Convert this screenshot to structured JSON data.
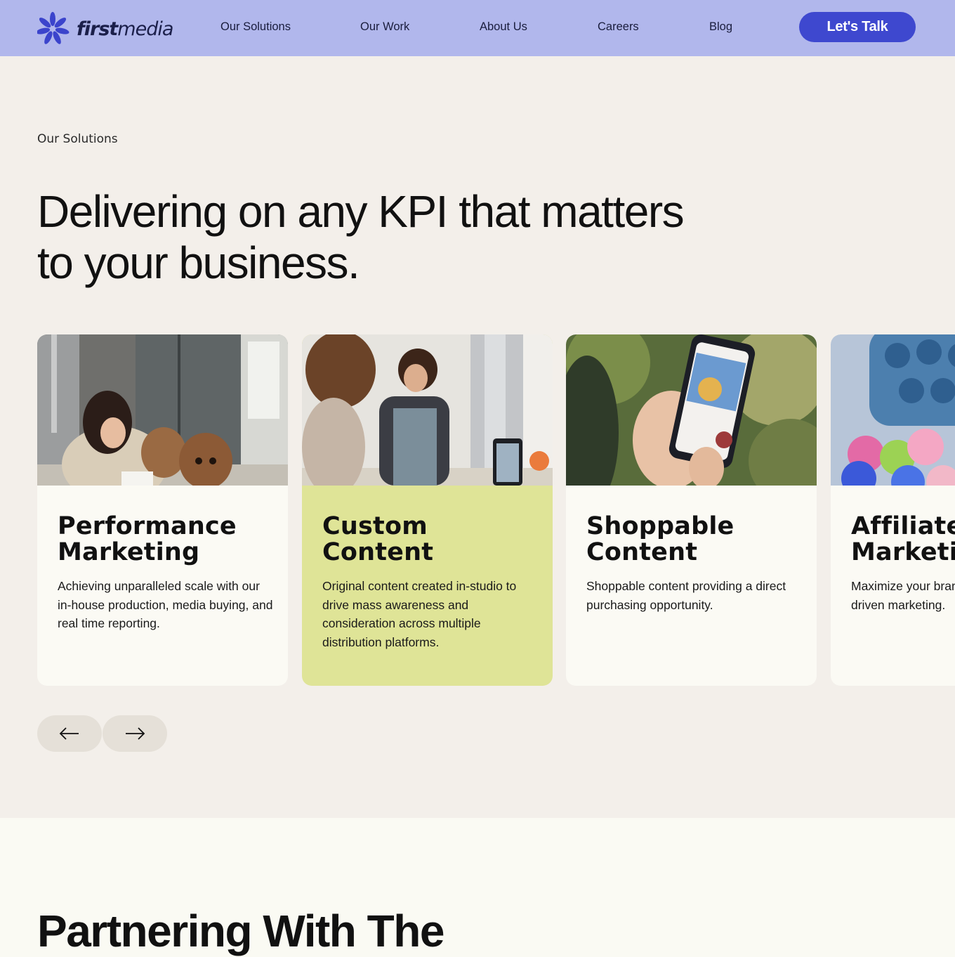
{
  "nav": {
    "logo_bold": "first",
    "logo_light": "media",
    "links": [
      "Our Solutions",
      "Our Work",
      "About Us",
      "Careers",
      "Blog"
    ],
    "cta": "Let's Talk"
  },
  "hero": {
    "eyebrow": "Our Solutions",
    "headline_line1": "Delivering on any KPI that matters",
    "headline_line2": "to your business."
  },
  "cards": [
    {
      "title_line1": "Performance",
      "title_line2": "Marketing",
      "description": "Achieving unparalleled scale with our in-house production, media buying, and real time reporting.",
      "image": "woman-with-dogs-photo"
    },
    {
      "title_line1": "Custom",
      "title_line2": "Content",
      "description": "Original content created in-studio to drive mass awareness and consideration across multiple distribution platforms.",
      "image": "kitchen-filming-photo"
    },
    {
      "title_line1": "Shoppable",
      "title_line2": "Content",
      "description": "Shoppable content providing a direct purchasing opportunity.",
      "image": "hand-holding-phone-photo"
    },
    {
      "title_line1": "Affiliate",
      "title_line2": "Marketing",
      "description": "Maximize your brand's performance-driven marketing.",
      "image": "cupcakes-photo"
    }
  ],
  "carousel": {
    "prev_icon": "arrow-left-icon",
    "next_icon": "arrow-right-icon"
  },
  "section2": {
    "title": "Partnering With The"
  },
  "colors": {
    "nav_bg": "#b1b7ec",
    "cta_bg": "#3e48cf",
    "page_bg": "#f3efea",
    "card_bg": "#fbfaf4",
    "card_active_bg": "#dfe497",
    "logo_flower": "#3b44cc"
  }
}
